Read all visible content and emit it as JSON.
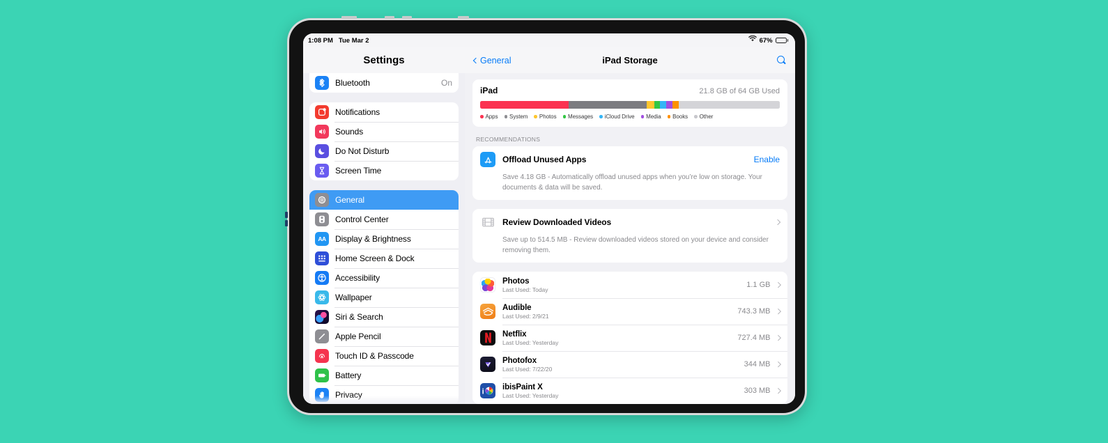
{
  "status_bar": {
    "time": "1:08 PM",
    "date": "Tue Mar 2",
    "wifi_icon": "wifi-icon",
    "battery_percent": "67%",
    "battery_icon": "battery-icon"
  },
  "sidebar": {
    "title": "Settings",
    "groups": [
      {
        "clipped": true,
        "items": [
          {
            "label": "Bluetooth",
            "value": "On",
            "icon": "bluetooth-icon",
            "icon_color": "#1b82f5",
            "glyph": "ᛦ",
            "selected": false
          }
        ]
      },
      {
        "clipped": false,
        "items": [
          {
            "label": "Notifications",
            "value": "",
            "icon": "notifications-icon",
            "icon_color": "#f33b2f",
            "glyph": "▢",
            "selected": false
          },
          {
            "label": "Sounds",
            "value": "",
            "icon": "sounds-icon",
            "icon_color": "#f2395c",
            "glyph": "ὐA",
            "selected": false
          },
          {
            "label": "Do Not Disturb",
            "value": "",
            "icon": "do-not-disturb-icon",
            "icon_color": "#5a4fe0",
            "glyph": "☽",
            "selected": false
          },
          {
            "label": "Screen Time",
            "value": "",
            "icon": "screen-time-icon",
            "icon_color": "#6a5cf0",
            "glyph": "⧗",
            "selected": false
          }
        ]
      },
      {
        "clipped": false,
        "items": [
          {
            "label": "General",
            "value": "",
            "icon": "general-gear-icon",
            "icon_color": "#8e8e93",
            "glyph": "⚙",
            "selected": true
          },
          {
            "label": "Control Center",
            "value": "",
            "icon": "control-center-icon",
            "icon_color": "#8e8e93",
            "glyph": "☰",
            "selected": false
          },
          {
            "label": "Display & Brightness",
            "value": "",
            "icon": "display-brightness-icon",
            "icon_color": "#2196f3",
            "glyph": "AA",
            "selected": false
          },
          {
            "label": "Home Screen & Dock",
            "value": "",
            "icon": "home-screen-dock-icon",
            "icon_color": "#2f4fd8",
            "glyph": "∶",
            "selected": false
          },
          {
            "label": "Accessibility",
            "value": "",
            "icon": "accessibility-icon",
            "icon_color": "#157bf5",
            "glyph": "ⓞ",
            "selected": false
          },
          {
            "label": "Wallpaper",
            "value": "",
            "icon": "wallpaper-icon",
            "icon_color": "#39b9ea",
            "glyph": "✻",
            "selected": false
          },
          {
            "label": "Siri & Search",
            "value": "",
            "icon": "siri-search-icon",
            "icon_color": "#2b1a45",
            "glyph": "✦",
            "selected": false
          },
          {
            "label": "Apple Pencil",
            "value": "",
            "icon": "apple-pencil-icon",
            "icon_color": "#8e8e93",
            "glyph": "╱",
            "selected": false
          },
          {
            "label": "Touch ID & Passcode",
            "value": "",
            "icon": "touch-id-passcode-icon",
            "icon_color": "#f5344f",
            "glyph": "◎",
            "selected": false
          },
          {
            "label": "Battery",
            "value": "",
            "icon": "battery-settings-icon",
            "icon_color": "#2fc24a",
            "glyph": "▭",
            "selected": false
          },
          {
            "label": "Privacy",
            "value": "",
            "icon": "privacy-hand-icon",
            "icon_color": "#1b82f5",
            "glyph": "✋",
            "selected": false
          }
        ]
      }
    ]
  },
  "detail": {
    "back_label": "General",
    "back_icon": "chevron-left-icon",
    "title": "iPad Storage",
    "search_icon": "search-icon",
    "storage": {
      "device_label": "iPad",
      "used_label": "21.8 GB of 64 GB Used",
      "segments": [
        {
          "name": "Apps",
          "color": "#fb3351",
          "percent": 29.5
        },
        {
          "name": "System",
          "color": "#7c7c80",
          "percent": 26.0
        },
        {
          "name": "Photos",
          "color": "#fec62e",
          "percent": 2.6
        },
        {
          "name": "Messages",
          "color": "#34c644",
          "percent": 2.0
        },
        {
          "name": "iCloud Drive",
          "color": "#34b5f6",
          "percent": 2.0
        },
        {
          "name": "Media",
          "color": "#a14fe0",
          "percent": 2.2
        },
        {
          "name": "Books",
          "color": "#ff9100",
          "percent": 2.0
        },
        {
          "name": "Other",
          "color": "#d4d4d8",
          "percent": 33.7
        }
      ],
      "legend": [
        {
          "label": "Apps",
          "color": "#fb3351"
        },
        {
          "label": "System",
          "color": "#8e8e93"
        },
        {
          "label": "Photos",
          "color": "#fec62e"
        },
        {
          "label": "Messages",
          "color": "#34c644"
        },
        {
          "label": "iCloud Drive",
          "color": "#34b5f6"
        },
        {
          "label": "Media",
          "color": "#a14fe0"
        },
        {
          "label": "Books",
          "color": "#ff9100"
        },
        {
          "label": "Other",
          "color": "#c7c7cc"
        }
      ]
    },
    "recommendations_header": "RECOMMENDATIONS",
    "recommendations": [
      {
        "title": "Offload Unused Apps",
        "icon": "app-store-icon",
        "icon_color": "#1d9bf6",
        "glyph": "𝐀",
        "action_label": "Enable",
        "action_type": "link",
        "description": "Save 4.18 GB - Automatically offload unused apps when you’re low on storage. Your documents & data will be saved."
      },
      {
        "title": "Review Downloaded Videos",
        "icon": "film-strip-icon",
        "icon_color": "#ffffff",
        "glyph": "▦",
        "action_label": "",
        "action_type": "chevron",
        "description": "Save up to 514.5 MB - Review downloaded videos stored on your device and consider removing them."
      }
    ],
    "apps": [
      {
        "name": "Photos",
        "sub": "Last Used: Today",
        "size": "1.1 GB",
        "icon": "photos-app-icon",
        "icon_color": "#ffffff",
        "glyph": ""
      },
      {
        "name": "Audible",
        "sub": "Last Used: 2/9/21",
        "size": "743.3 MB",
        "icon": "audible-app-icon",
        "icon_color": "#f08a1e",
        "glyph": "≋"
      },
      {
        "name": "Netflix",
        "sub": "Last Used: Yesterday",
        "size": "727.4 MB",
        "icon": "netflix-app-icon",
        "icon_color": "#0d0d0d",
        "glyph": "N"
      },
      {
        "name": "Photofox",
        "sub": "Last Used: 7/22/20",
        "size": "344 MB",
        "icon": "photofox-app-icon",
        "icon_color": "#17172b",
        "glyph": "▼"
      },
      {
        "name": "ibisPaint X",
        "sub": "Last Used: Yesterday",
        "size": "303 MB",
        "icon": "ibispaint-app-icon",
        "icon_color": "#1f4fa8",
        "glyph": "◕"
      }
    ],
    "chevron_icon": "chevron-right-icon"
  },
  "theme": {
    "background": "#3BD4B4",
    "accent_blue": "#067bf7",
    "selected_row": "#3f9bf4"
  }
}
